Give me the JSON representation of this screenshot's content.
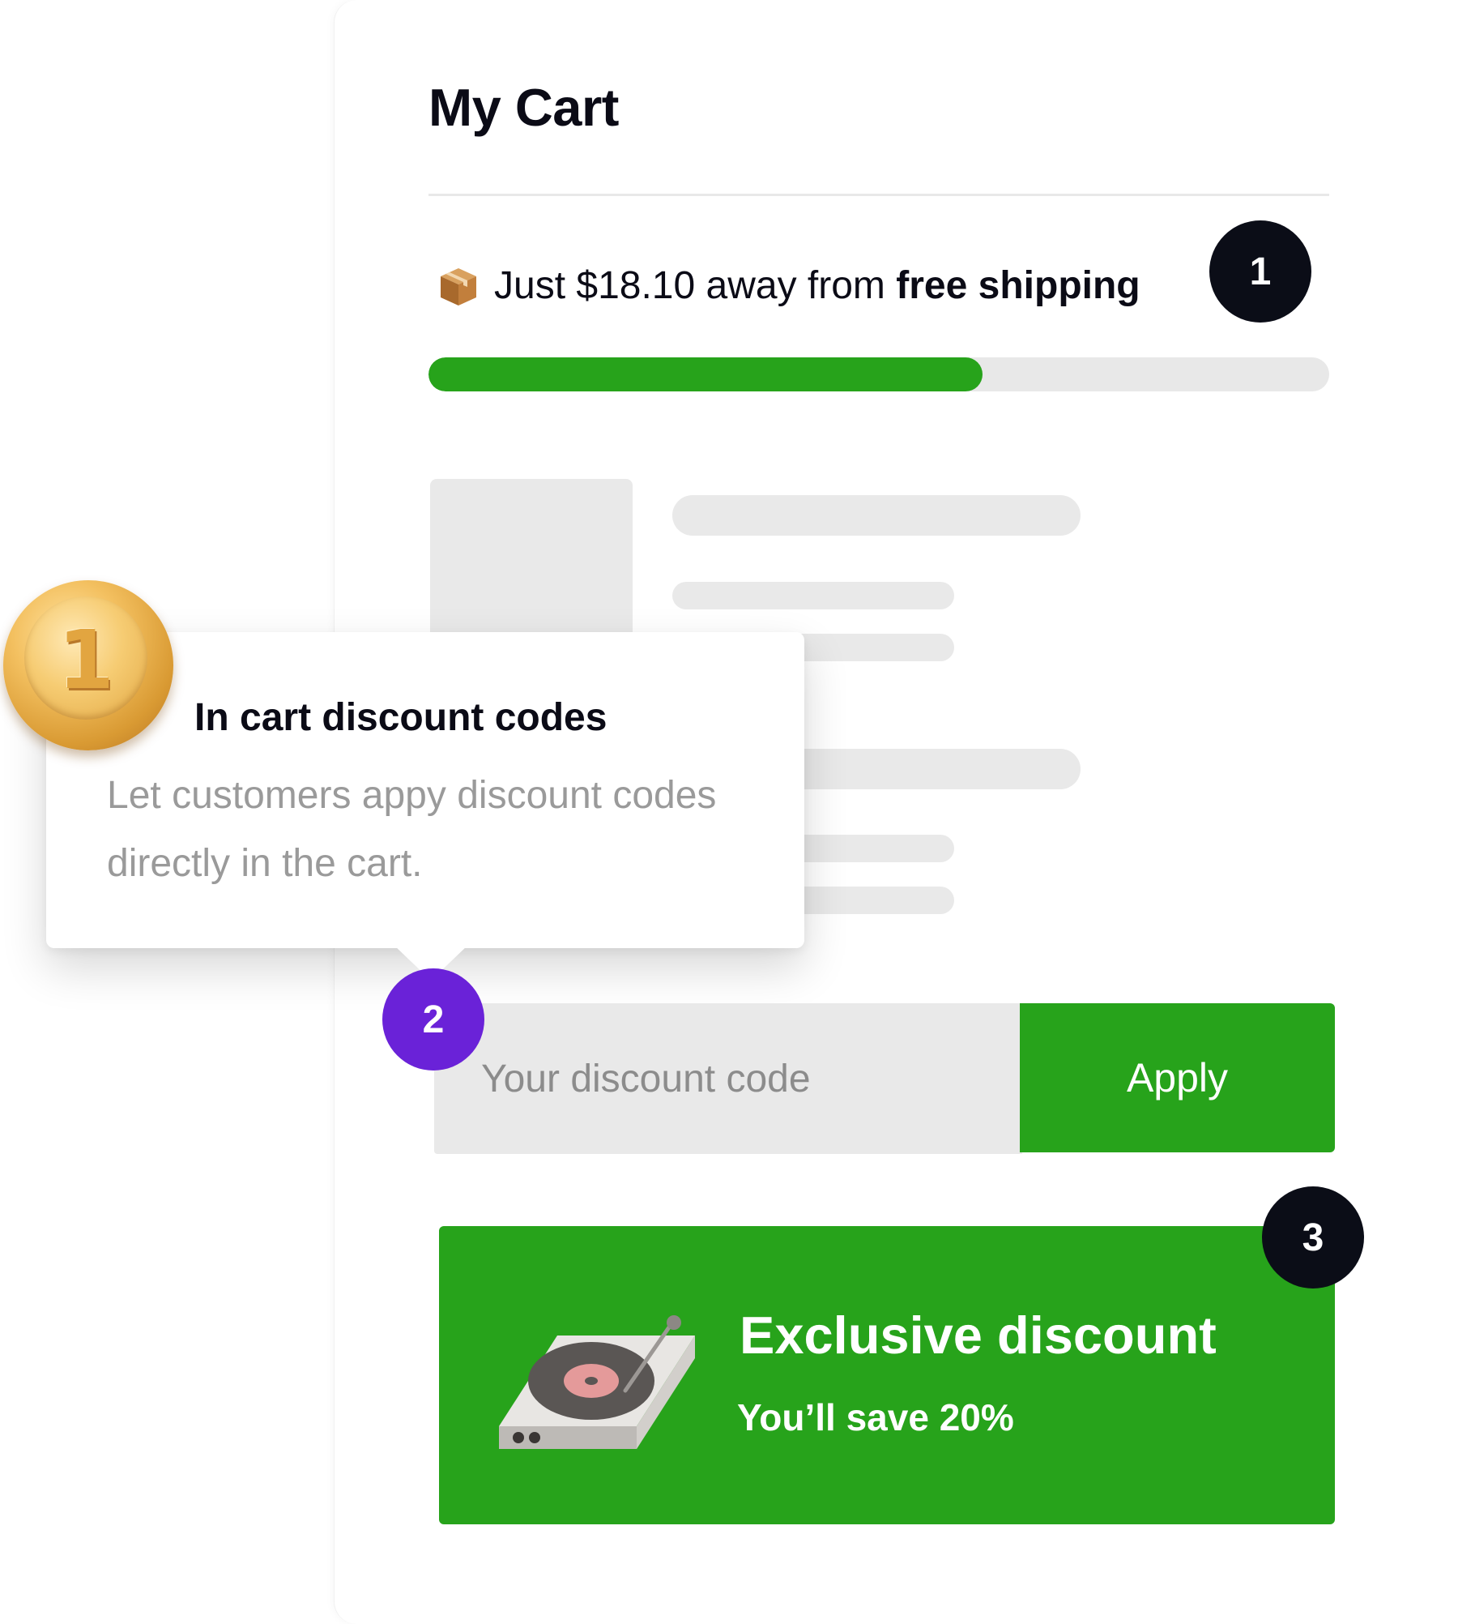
{
  "cart": {
    "title": "My Cart"
  },
  "shipping": {
    "prefix": "Just $18.10 away from ",
    "emphasis": "free shipping",
    "icon": "package-icon",
    "progress_percent": 61.5
  },
  "badges": {
    "step1": "1",
    "step2": "2",
    "step3": "3"
  },
  "tooltip": {
    "title": "In cart discount codes",
    "description": "Let customers appy discount codes directly in the cart.",
    "coin_digit": "1"
  },
  "discount": {
    "placeholder": "Your discount code",
    "apply_label": "Apply"
  },
  "promo": {
    "title": "Exclusive discount",
    "subtitle": "You’ll save 20%",
    "icon": "turntable-icon"
  },
  "colors": {
    "brand_green": "#27a31b",
    "badge_dark": "#0b0d17",
    "badge_purple": "#6a22d8",
    "skeleton_grey": "#e9e9e9"
  }
}
